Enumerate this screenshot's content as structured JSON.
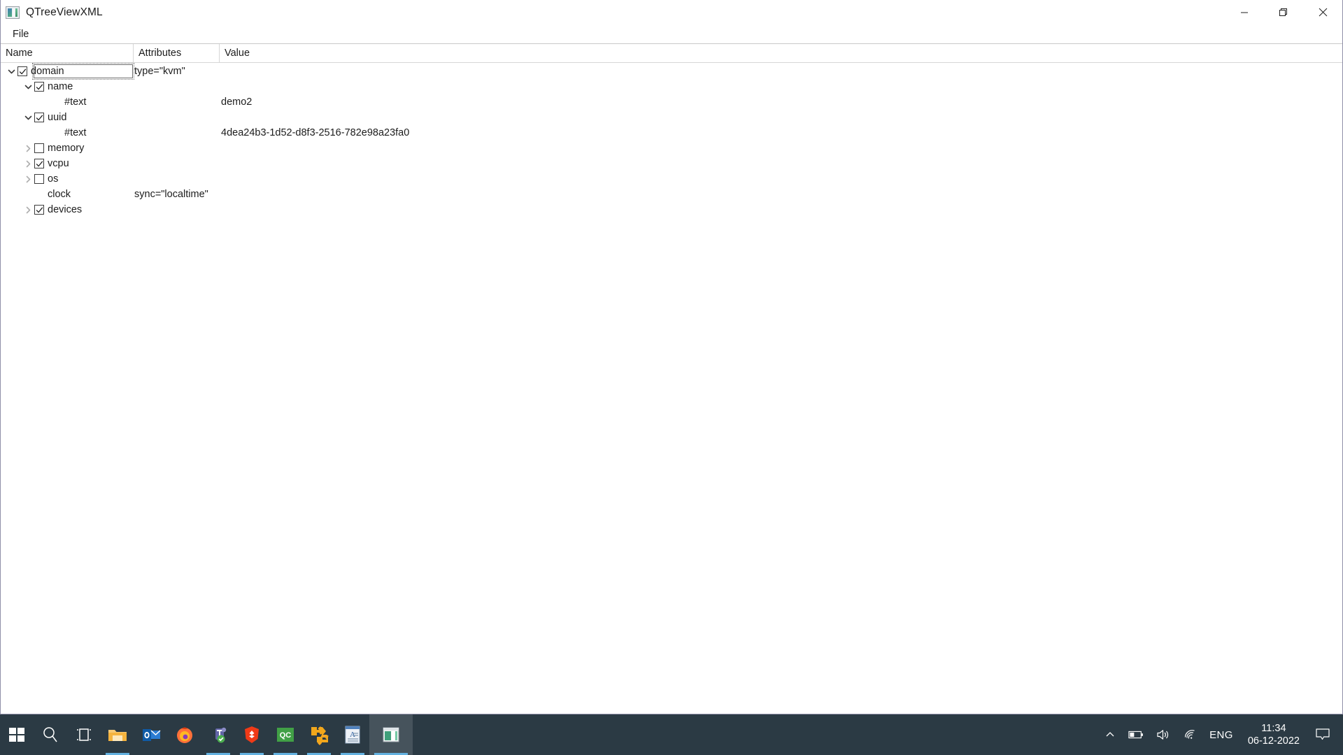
{
  "window": {
    "title": "QTreeViewXML",
    "icon": "app-window-icon",
    "controls": {
      "minimize": "minimize-icon",
      "restore": "restore-icon",
      "close": "close-icon"
    }
  },
  "menu": {
    "items": [
      {
        "label": "File"
      }
    ]
  },
  "tree": {
    "columns": [
      {
        "key": "name",
        "label": "Name"
      },
      {
        "key": "attributes",
        "label": "Attributes"
      },
      {
        "key": "value",
        "label": "Value"
      }
    ],
    "rows": [
      {
        "name": "domain",
        "attributes": "type=\"kvm\"",
        "value": "",
        "indent": 0,
        "expander": "expanded",
        "checkbox": "checked",
        "editing": true
      },
      {
        "name": "name",
        "attributes": "",
        "value": "",
        "indent": 1,
        "expander": "expanded",
        "checkbox": "checked",
        "editing": false
      },
      {
        "name": "#text",
        "attributes": "",
        "value": "demo2",
        "indent": 2,
        "expander": "none",
        "checkbox": "none",
        "editing": false
      },
      {
        "name": "uuid",
        "attributes": "",
        "value": "",
        "indent": 1,
        "expander": "expanded",
        "checkbox": "checked",
        "editing": false
      },
      {
        "name": "#text",
        "attributes": "",
        "value": "4dea24b3-1d52-d8f3-2516-782e98a23fa0",
        "indent": 2,
        "expander": "none",
        "checkbox": "none",
        "editing": false
      },
      {
        "name": "memory",
        "attributes": "",
        "value": "",
        "indent": 1,
        "expander": "collapsed",
        "checkbox": "unchecked",
        "editing": false
      },
      {
        "name": "vcpu",
        "attributes": "",
        "value": "",
        "indent": 1,
        "expander": "collapsed",
        "checkbox": "checked",
        "editing": false
      },
      {
        "name": "os",
        "attributes": "",
        "value": "",
        "indent": 1,
        "expander": "collapsed",
        "checkbox": "unchecked",
        "editing": false
      },
      {
        "name": "clock",
        "attributes": "sync=\"localtime\"",
        "value": "",
        "indent": 1,
        "expander": "none",
        "checkbox": "none",
        "editing": false
      },
      {
        "name": "devices",
        "attributes": "",
        "value": "",
        "indent": 1,
        "expander": "collapsed",
        "checkbox": "checked",
        "editing": false
      }
    ]
  },
  "taskbar": {
    "items": [
      {
        "name": "start-button",
        "icon": "windows-logo-icon",
        "label": "Start",
        "running": false
      },
      {
        "name": "search-button",
        "icon": "search-icon",
        "label": "Search",
        "running": false
      },
      {
        "name": "task-view-button",
        "icon": "task-view-icon",
        "label": "Task View",
        "running": false
      },
      {
        "name": "file-explorer",
        "icon": "folder-icon",
        "label": "File Explorer",
        "running": true
      },
      {
        "name": "outlook",
        "icon": "outlook-icon",
        "label": "Outlook",
        "running": false
      },
      {
        "name": "firefox",
        "icon": "firefox-icon",
        "label": "Firefox",
        "running": false
      },
      {
        "name": "microsoft-teams",
        "icon": "teams-icon",
        "label": "Microsoft Teams",
        "running": true
      },
      {
        "name": "brave-browser",
        "icon": "brave-icon",
        "label": "Brave",
        "running": true
      },
      {
        "name": "qt-creator",
        "icon": "qt-creator-icon",
        "label": "QC",
        "running": true
      },
      {
        "name": "visio",
        "icon": "visio-icon",
        "label": "Visio",
        "running": true
      },
      {
        "name": "wordpad",
        "icon": "wordpad-icon",
        "label": "WordPad",
        "running": true
      },
      {
        "name": "qtreeviewxml-app",
        "icon": "app-window-icon",
        "label": "QTreeViewXML",
        "running": true,
        "active": true
      }
    ],
    "tray": {
      "chevron": "show-hidden-icons-icon",
      "battery": "battery-icon",
      "volume": "volume-icon",
      "network": "wifi-icon",
      "language": "ENG",
      "time": "11:34",
      "date": "06-12-2022",
      "notifications": "notification-center-icon"
    }
  },
  "colors": {
    "taskbar_bg": "#2b3a44",
    "accent": "#63b1e0",
    "window_bg": "#ffffff",
    "text": "#1c1c1c"
  }
}
